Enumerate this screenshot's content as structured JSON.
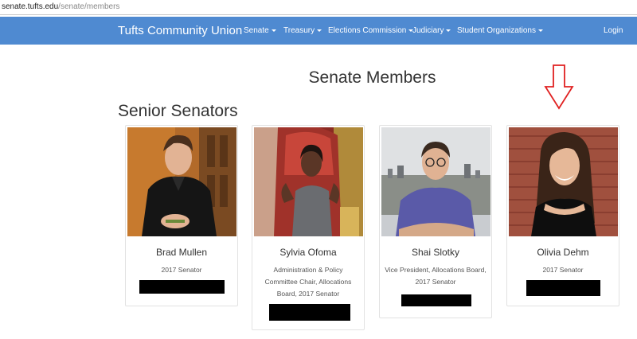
{
  "browser": {
    "url_host": "senate.tufts.edu",
    "url_path": "/senate/members"
  },
  "navbar": {
    "brand": "Tufts Community Union",
    "items": [
      {
        "label": "Senate",
        "dropdown": true
      },
      {
        "label": "Treasury",
        "dropdown": true
      },
      {
        "label": "Elections Commission",
        "dropdown": true
      },
      {
        "label": "Judiciary",
        "dropdown": true
      },
      {
        "label": "Student Organizations",
        "dropdown": true
      }
    ],
    "login": "Login",
    "color": "#4f8ad1"
  },
  "page": {
    "title": "Senate Members",
    "section": "Senior Senators"
  },
  "senators": [
    {
      "name": "Brad Mullen",
      "role": "2017 Senator"
    },
    {
      "name": "Sylvia Ofoma",
      "role": "Administration & Policy Committee Chair, Allocations Board, 2017 Senator"
    },
    {
      "name": "Shai Slotky",
      "role": "Vice President, Allocations Board, 2017 Senator"
    },
    {
      "name": "Olivia Dehm",
      "role": "2017 Senator"
    }
  ],
  "annotation": {
    "icon": "down-arrow-icon",
    "color": "#e02020"
  }
}
